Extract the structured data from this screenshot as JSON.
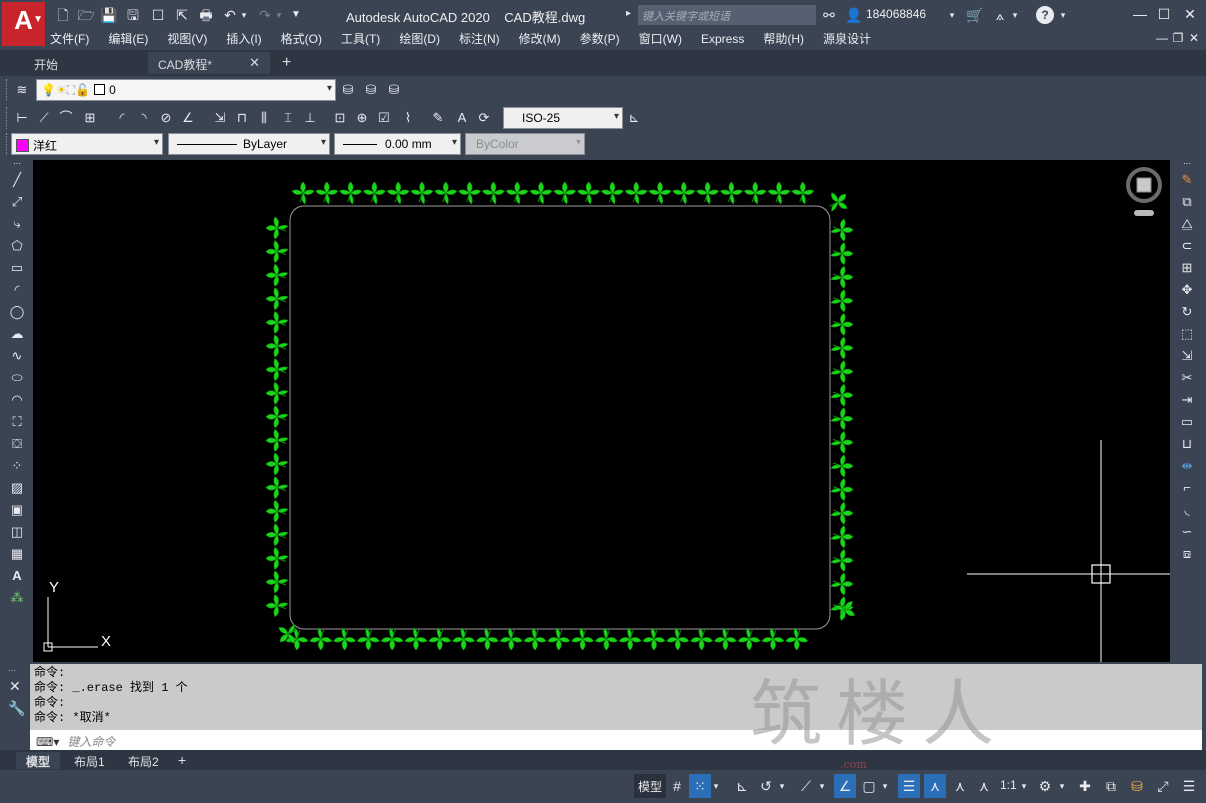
{
  "titlebar": {
    "logo_letter": "A",
    "app_title": "Autodesk AutoCAD 2020",
    "doc_title": "CAD教程.dwg",
    "search_placeholder": "键入关键字或短语",
    "username": "184068846"
  },
  "menu": [
    "文件(F)",
    "编辑(E)",
    "视图(V)",
    "插入(I)",
    "格式(O)",
    "工具(T)",
    "绘图(D)",
    "标注(N)",
    "修改(M)",
    "参数(P)",
    "窗口(W)",
    "Express",
    "帮助(H)",
    "源泉设计"
  ],
  "tabs": [
    {
      "label": "开始"
    },
    {
      "label": "CAD教程*"
    }
  ],
  "layer": {
    "name": "0"
  },
  "dimstyle": {
    "value": "ISO-25"
  },
  "properties": {
    "color": "洋红",
    "linetype": "ByLayer",
    "lineweight": "0.00 mm",
    "plotstyle": "ByColor"
  },
  "ucs": {
    "x_label": "X",
    "y_label": "Y"
  },
  "command_history": [
    "命令:",
    "命令: _.erase 找到 1 个",
    "命令:",
    "命令: *取消*"
  ],
  "command_placeholder": "键入命令",
  "layout_tabs": [
    "模型",
    "布局1",
    "布局2"
  ],
  "status": {
    "model_label": "模型",
    "scale": "1:1"
  },
  "watermark": {
    "text": "筑楼人",
    "site": ".com"
  },
  "colors": {
    "accent": "#c8242c",
    "border_green": "#1bd41b",
    "magenta": "#ff00ff"
  }
}
